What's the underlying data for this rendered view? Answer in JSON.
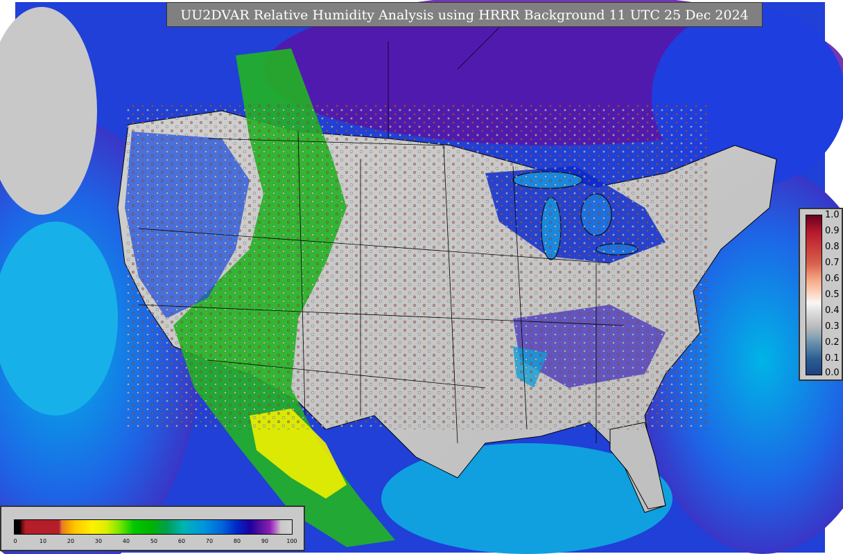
{
  "title": "UU2DVAR Relative Humidity Analysis using HRRR Background 11 UTC 25 Dec 2024",
  "rh_colorbar": {
    "ticks": [
      "0",
      "10",
      "20",
      "30",
      "40",
      "50",
      "60",
      "70",
      "80",
      "90",
      "100"
    ]
  },
  "prob_colorbar": {
    "ticks": [
      "1.0",
      "0.9",
      "0.8",
      "0.7",
      "0.6",
      "0.5",
      "0.4",
      "0.3",
      "0.2",
      "0.1",
      "0.0"
    ]
  },
  "colors": {
    "ocean_moist": "#1e4ee6",
    "ocean_very_moist": "#6a1aa8",
    "land_dry": "#c8c8c8",
    "land_green": "#22b422",
    "land_yellow": "#f0f000",
    "border": "#000000"
  }
}
